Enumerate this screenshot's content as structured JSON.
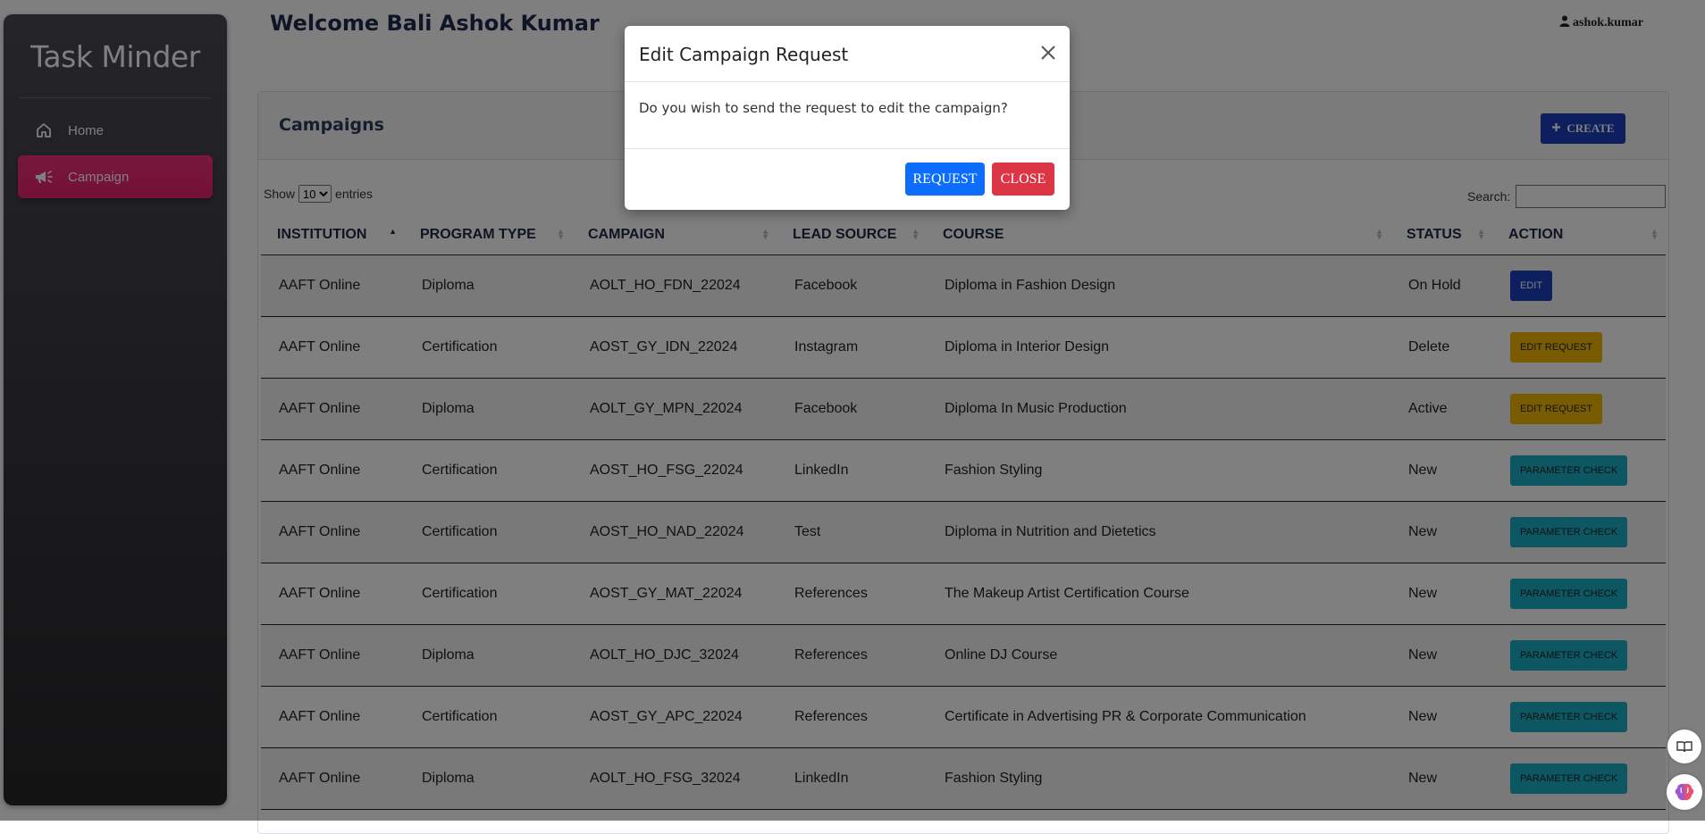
{
  "app": {
    "brand": "Task Minder",
    "nav": [
      {
        "label": "Home",
        "icon": "home-icon"
      },
      {
        "label": "Campaign",
        "icon": "megaphone-icon",
        "active": true
      }
    ]
  },
  "header": {
    "welcome": "Welcome Bali Ashok Kumar",
    "user": "ashok.kumar"
  },
  "campaigns": {
    "title": "Campaigns",
    "create_label": "CREATE",
    "show_label": "Show",
    "entries_label": "entries",
    "page_size": "10",
    "search_label": "Search:",
    "search_value": "",
    "columns": [
      "INSTITUTION",
      "PROGRAM TYPE",
      "CAMPAIGN",
      "LEAD SOURCE",
      "COURSE",
      "STATUS",
      "ACTION"
    ],
    "sorted_column": "INSTITUTION",
    "rows": [
      {
        "institution": "AAFT Online",
        "program_type": "Diploma",
        "campaign": "AOLT_HO_FDN_22024",
        "lead_source": "Facebook",
        "course": "Diploma in Fashion Design",
        "status": "On Hold",
        "action": "EDIT",
        "action_style": "edit"
      },
      {
        "institution": "AAFT Online",
        "program_type": "Certification",
        "campaign": "AOST_GY_IDN_22024",
        "lead_source": "Instagram",
        "course": "Diploma in Interior Design",
        "status": "Delete",
        "action": "EDIT REQUEST",
        "action_style": "editreq"
      },
      {
        "institution": "AAFT Online",
        "program_type": "Diploma",
        "campaign": "AOLT_GY_MPN_22024",
        "lead_source": "Facebook",
        "course": "Diploma In Music Production",
        "status": "Active",
        "action": "EDIT REQUEST",
        "action_style": "editreq"
      },
      {
        "institution": "AAFT Online",
        "program_type": "Certification",
        "campaign": "AOST_HO_FSG_22024",
        "lead_source": "LinkedIn",
        "course": "Fashion Styling",
        "status": "New",
        "action": "PARAMETER CHECK",
        "action_style": "param"
      },
      {
        "institution": "AAFT Online",
        "program_type": "Certification",
        "campaign": "AOST_HO_NAD_22024",
        "lead_source": "Test",
        "course": "Diploma in Nutrition and Dietetics",
        "status": "New",
        "action": "PARAMETER CHECK",
        "action_style": "param"
      },
      {
        "institution": "AAFT Online",
        "program_type": "Certification",
        "campaign": "AOST_GY_MAT_22024",
        "lead_source": "References",
        "course": "The Makeup Artist Certification Course",
        "status": "New",
        "action": "PARAMETER CHECK",
        "action_style": "param"
      },
      {
        "institution": "AAFT Online",
        "program_type": "Diploma",
        "campaign": "AOLT_HO_DJC_32024",
        "lead_source": "References",
        "course": "Online DJ Course",
        "status": "New",
        "action": "PARAMETER CHECK",
        "action_style": "param"
      },
      {
        "institution": "AAFT Online",
        "program_type": "Certification",
        "campaign": "AOST_GY_APC_22024",
        "lead_source": "References",
        "course": "Certificate in Advertising PR & Corporate Communication",
        "status": "New",
        "action": "PARAMETER CHECK",
        "action_style": "param"
      },
      {
        "institution": "AAFT Online",
        "program_type": "Diploma",
        "campaign": "AOLT_HO_FSG_32024",
        "lead_source": "LinkedIn",
        "course": "Fashion Styling",
        "status": "New",
        "action": "PARAMETER CHECK",
        "action_style": "param"
      }
    ]
  },
  "modal": {
    "title": "Edit Campaign Request",
    "message": "Do you wish to send the request to edit the campaign?",
    "request_label": "REQUEST",
    "close_label": "CLOSE"
  },
  "colors": {
    "accent": "#e8226a",
    "primary": "#0d6efd",
    "danger": "#dc3545",
    "create": "#1d3fbf",
    "warning": "#f2b705",
    "info": "#19aec4"
  }
}
